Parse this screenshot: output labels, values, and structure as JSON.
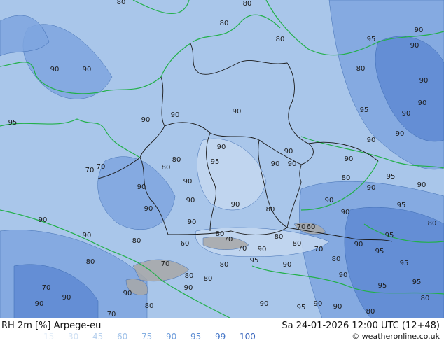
{
  "header": {
    "title": "RH 2m [%] Arpege-eu",
    "valid": "Sa 24-01-2026 12:00 UTC (12+48)",
    "credit": "© weatheronline.co.uk"
  },
  "legend": {
    "values": [
      "15",
      "30",
      "45",
      "60",
      "75",
      "90",
      "95",
      "99",
      "100"
    ],
    "colors": [
      "#e4eef8",
      "#cfe0f3",
      "#b8d1ee",
      "#9fc1e8",
      "#86b0e2",
      "#6d9cdb",
      "#5a8bd2",
      "#4677c8",
      "#3a66bd"
    ]
  },
  "map": {
    "colors": {
      "base": "#a9c6ea",
      "moist": "#7fa6e0",
      "very_moist": "#5f8ad4",
      "dry": "#c5d8f1",
      "alps_rock": "#a8a8a8",
      "coast": "#22b04a",
      "border": "#1a1a1a"
    },
    "contour_labels": [
      "80",
      "80",
      "80",
      "90",
      "80",
      "95",
      "90",
      "90",
      "90",
      "80",
      "90",
      "90",
      "95",
      "90",
      "90",
      "90",
      "90",
      "95",
      "90",
      "90",
      "90",
      "90",
      "90",
      "80",
      "95",
      "90",
      "90",
      "70",
      "80",
      "70",
      "90",
      "80",
      "90",
      "90",
      "95",
      "90",
      "90",
      "90",
      "90",
      "95",
      "90",
      "80",
      "90",
      "80",
      "90",
      "90",
      "80",
      "70",
      "60",
      "95",
      "90",
      "80",
      "70",
      "60",
      "80",
      "90",
      "70",
      "70",
      "90",
      "80",
      "80",
      "95",
      "90",
      "95",
      "80",
      "80",
      "70",
      "80",
      "80",
      "95",
      "90",
      "95",
      "70",
      "90",
      "80",
      "90",
      "90",
      "95",
      "90",
      "80",
      "90",
      "95",
      "90",
      "70",
      "90",
      "80"
    ]
  }
}
